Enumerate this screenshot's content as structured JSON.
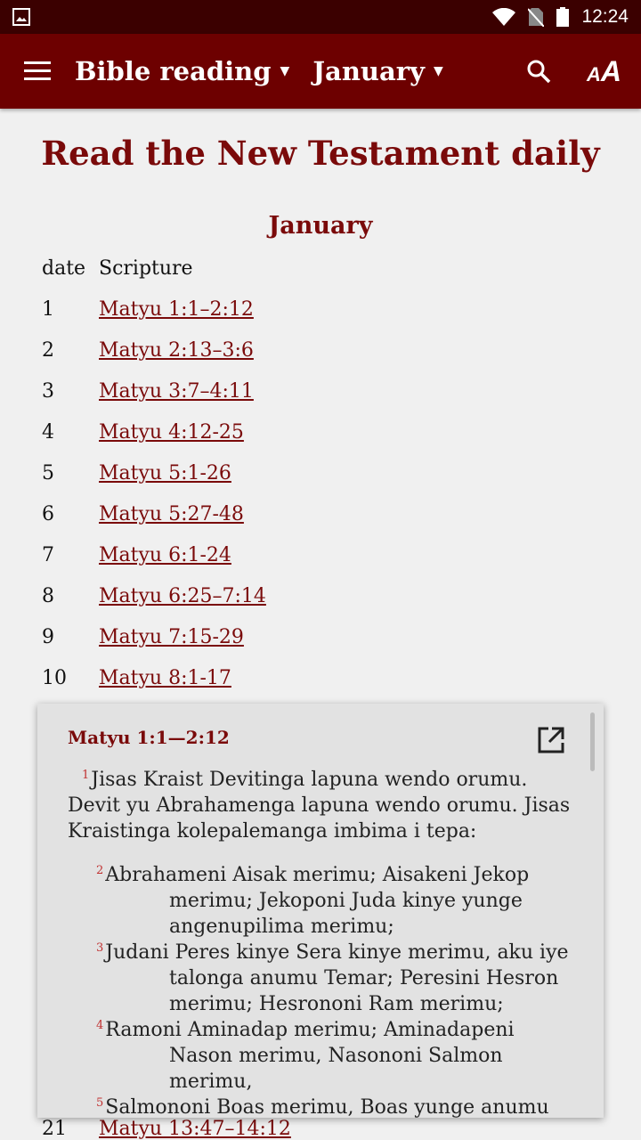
{
  "status": {
    "time": "12:24",
    "icons": [
      "image-icon",
      "wifi-icon",
      "no-sim-icon",
      "battery-icon"
    ]
  },
  "appbar": {
    "menu_icon": "hamburger-icon",
    "book_selector": "Bible reading",
    "month_selector": "January",
    "search_icon": "search-icon",
    "text_size_icon": "text-size-icon"
  },
  "page": {
    "title": "Read the New Testament daily",
    "month": "January",
    "col_date": "date",
    "col_scripture": "Scripture"
  },
  "rows": [
    {
      "date": "1",
      "ref": "Matyu 1:1–2:12"
    },
    {
      "date": "2",
      "ref": "Matyu 2:13–3:6"
    },
    {
      "date": "3",
      "ref": "Matyu 3:7–4:11"
    },
    {
      "date": "4",
      "ref": "Matyu 4:12-25"
    },
    {
      "date": "5",
      "ref": "Matyu 5:1-26"
    },
    {
      "date": "6",
      "ref": "Matyu 5:27-48"
    },
    {
      "date": "7",
      "ref": "Matyu 6:1-24"
    },
    {
      "date": "8",
      "ref": "Matyu 6:25–7:14"
    },
    {
      "date": "9",
      "ref": "Matyu 7:15-29"
    },
    {
      "date": "10",
      "ref": "Matyu 8:1-17"
    },
    {
      "date": "21",
      "ref": "Matyu 13:47–14:12"
    }
  ],
  "popup": {
    "ref": "Matyu 1:1—2:12",
    "open_icon": "open-external-icon",
    "verses": [
      {
        "n": "1",
        "text": "Jisas Kraist Devitinga lapuna wendo orumu. Devit yu Abrahamenga lapuna wendo orumu. Jisas Kraistinga kolepalemanga imbima i tepa:"
      },
      {
        "n": "2",
        "text": "Abrahameni Aisak merimu; Aisakeni Jekop merimu; Jekoponi Juda kinye yunge angenupilima merimu;"
      },
      {
        "n": "3",
        "text": "Judani Peres kinye Sera kinye merimu, aku iye talonga anumu Temar; Peresini Hesron merimu; Hesrononi Ram merimu;"
      },
      {
        "n": "4",
        "text": "Ramoni Aminadap merimu; Aminadapeni Nason merimu, Nasononi Salmon merimu,"
      },
      {
        "n": "5",
        "text": "Salmononi Boas merimu, Boas yunge anumu Rahap; Boasini Obet merimu, Obet yunge"
      }
    ]
  },
  "colors": {
    "appbar": "#6d0000",
    "status": "#3b0000",
    "accent": "#7a0a0a",
    "verse_number": "#c03030"
  }
}
